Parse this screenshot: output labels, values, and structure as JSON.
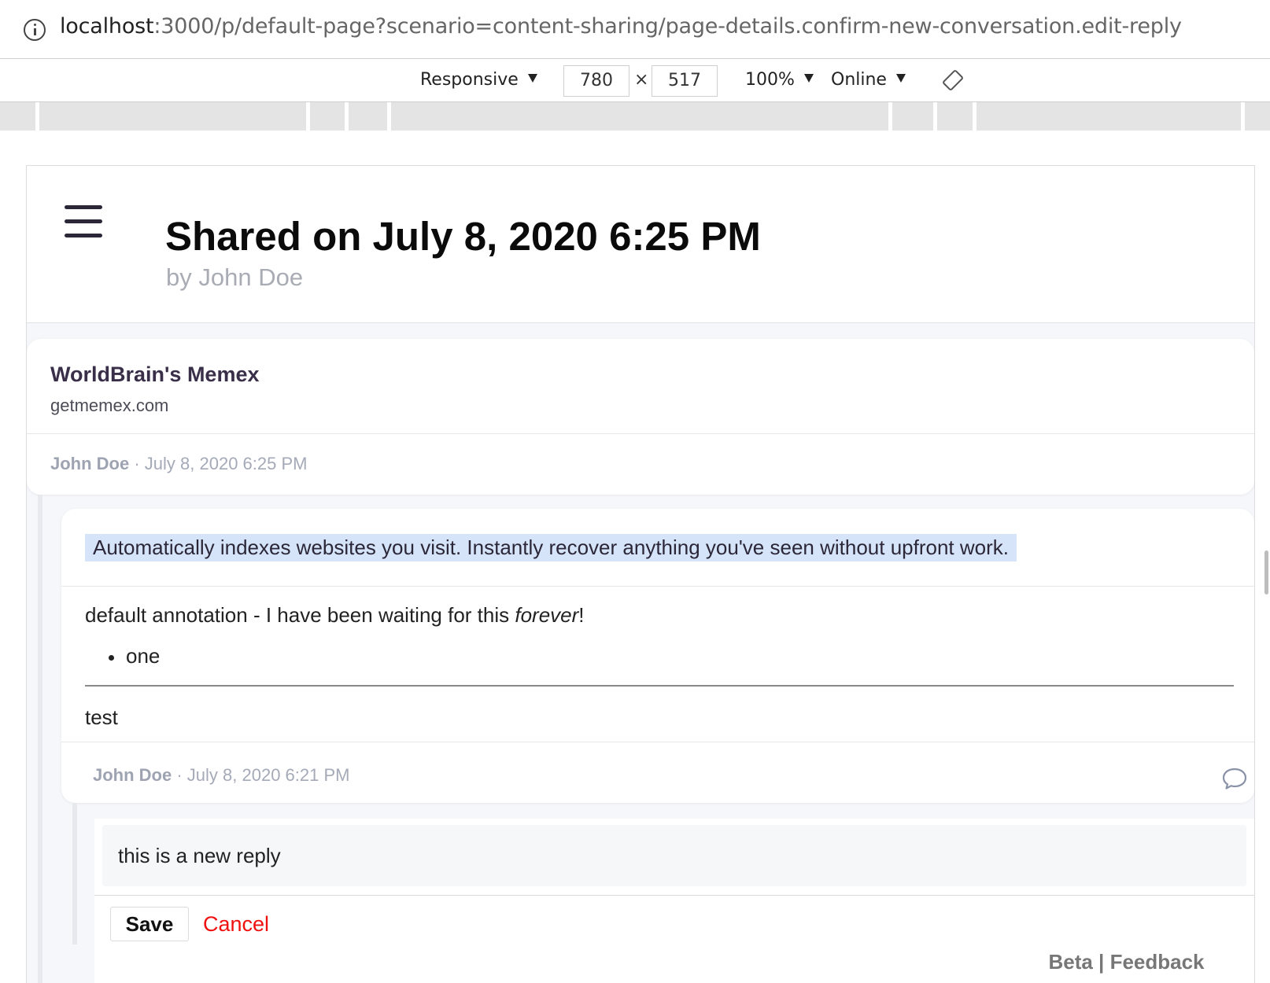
{
  "browser": {
    "url_host": "localhost",
    "url_rest": ":3000/p/default-page?scenario=content-sharing/page-details.confirm-new-conversation.edit-reply"
  },
  "device_toolbar": {
    "device": "Responsive",
    "width": "780",
    "times": "×",
    "height": "517",
    "zoom": "100%",
    "network": "Online"
  },
  "header": {
    "title": "Shared on July 8, 2020 6:25 PM",
    "subtitle": "by John Doe"
  },
  "page_card": {
    "site_title": "WorldBrain's Memex",
    "site_url": "getmemex.com",
    "author": "John Doe",
    "separator": " · ",
    "date": "July 8, 2020 6:25 PM"
  },
  "annotation": {
    "highlight": "Automatically indexes websites you visit. Instantly recover anything you've seen without upfront work.",
    "comment_prefix": "default annotation - I have been waiting for this ",
    "comment_em": "forever",
    "comment_suffix": "!",
    "bullet": "one",
    "second_paragraph": "test",
    "author": "John Doe",
    "separator": " · ",
    "date": "July 8, 2020 6:21 PM"
  },
  "reply_editor": {
    "value": "this is a new reply",
    "save_label": "Save",
    "cancel_label": "Cancel"
  },
  "feedback": {
    "beta": "Beta",
    "pipe": " | ",
    "feedback": "Feedback"
  },
  "icons": {
    "info": "info-icon",
    "menu": "hamburger-menu-icon",
    "rotate": "rotate-device-icon",
    "reply": "speech-bubble-icon"
  },
  "colors": {
    "highlight": "#d5e4f8",
    "cancel": "#f01010",
    "title": "#0b0b0b",
    "meta": "#a5aab8"
  }
}
